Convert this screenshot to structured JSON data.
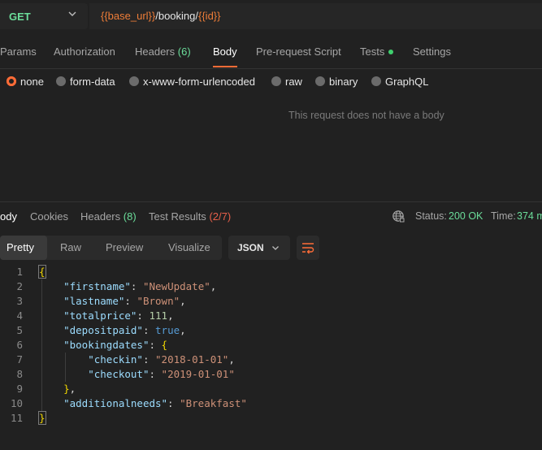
{
  "request": {
    "method": "GET",
    "url_parts": [
      {
        "text": "{{base_url}}",
        "type": "var"
      },
      {
        "text": "/booking/",
        "type": "plain"
      },
      {
        "text": "{{id}}",
        "type": "var"
      }
    ],
    "tabs": {
      "params": "Params",
      "authorization": "Authorization",
      "headers": "Headers",
      "headers_count": "(6)",
      "body": "Body",
      "prerequest": "Pre-request Script",
      "tests": "Tests",
      "settings": "Settings"
    },
    "body_types": {
      "none": "none",
      "form_data": "form-data",
      "urlencoded": "x-www-form-urlencoded",
      "raw": "raw",
      "binary": "binary",
      "graphql": "GraphQL"
    },
    "no_body_message": "This request does not have a body"
  },
  "response": {
    "tabs": {
      "body": "ody",
      "cookies": "Cookies",
      "headers": "Headers",
      "headers_count": "(8)",
      "test_results": "Test Results",
      "test_results_count": "(2/7)"
    },
    "status_label": "Status:",
    "status_value": "200 OK",
    "time_label": "Time:",
    "time_value": "374 m",
    "views": {
      "pretty": "Pretty",
      "raw": "Raw",
      "preview": "Preview",
      "visualize": "Visualize"
    },
    "format": "JSON",
    "line_numbers": [
      "1",
      "2",
      "3",
      "4",
      "5",
      "6",
      "7",
      "8",
      "9",
      "10",
      "11"
    ]
  },
  "icons": {
    "method_dropdown": "chevron-down-icon",
    "globe": "globe-icon",
    "format_dropdown": "chevron-down-icon",
    "wrap": "wrap-lines-icon"
  },
  "colors": {
    "accent": "#ff6c37",
    "success": "#6bdd9a",
    "variable": "#ee7d38",
    "error": "#e8604a"
  }
}
